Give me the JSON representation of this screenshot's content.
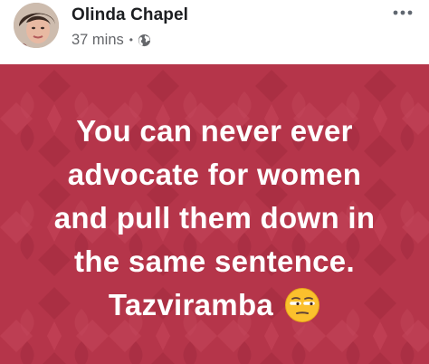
{
  "post": {
    "author": "Olinda Chapel",
    "timestamp": "37 mins",
    "separator": "•",
    "privacy_icon": "globe-icon",
    "more_icon": "more-dots-icon"
  },
  "content": {
    "background_color": "#b5354a",
    "lines": [
      "You can never ever",
      "advocate for women",
      "and pull them down in",
      "the same sentence.",
      "Tazviramba"
    ],
    "emoji": "unamused-face-emoji"
  }
}
